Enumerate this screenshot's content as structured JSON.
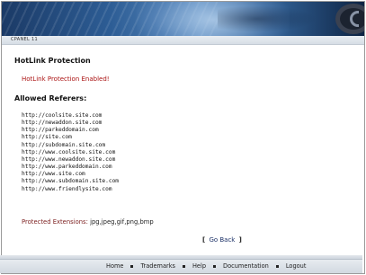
{
  "header": {
    "subbar_label": "CPANEL 11"
  },
  "main": {
    "title": "HotLink Protection",
    "status_message": "HotLink Protection Enabled!",
    "referers_heading": "Allowed Referers:",
    "referers": [
      "http://coolsite.site.com",
      "http://newaddon.site.com",
      "http://parkeddomain.com",
      "http://site.com",
      "http://subdomain.site.com",
      "http://www.coolsite.site.com",
      "http://www.newaddon.site.com",
      "http://www.parkeddomain.com",
      "http://www.site.com",
      "http://www.subdomain.site.com",
      "http://www.friendlysite.com"
    ],
    "extensions_label": "Protected Extensions:",
    "extensions_value": "jpg,jpeg,gif,png,bmp",
    "go_back": {
      "open": "[",
      "label": "Go Back",
      "close": "]"
    }
  },
  "footer": {
    "links": [
      "Home",
      "Trademarks",
      "Help",
      "Documentation",
      "Logout"
    ]
  },
  "colors": {
    "banner": "#2d5d95",
    "status_text": "#aa1111",
    "link": "#1a2f66"
  }
}
